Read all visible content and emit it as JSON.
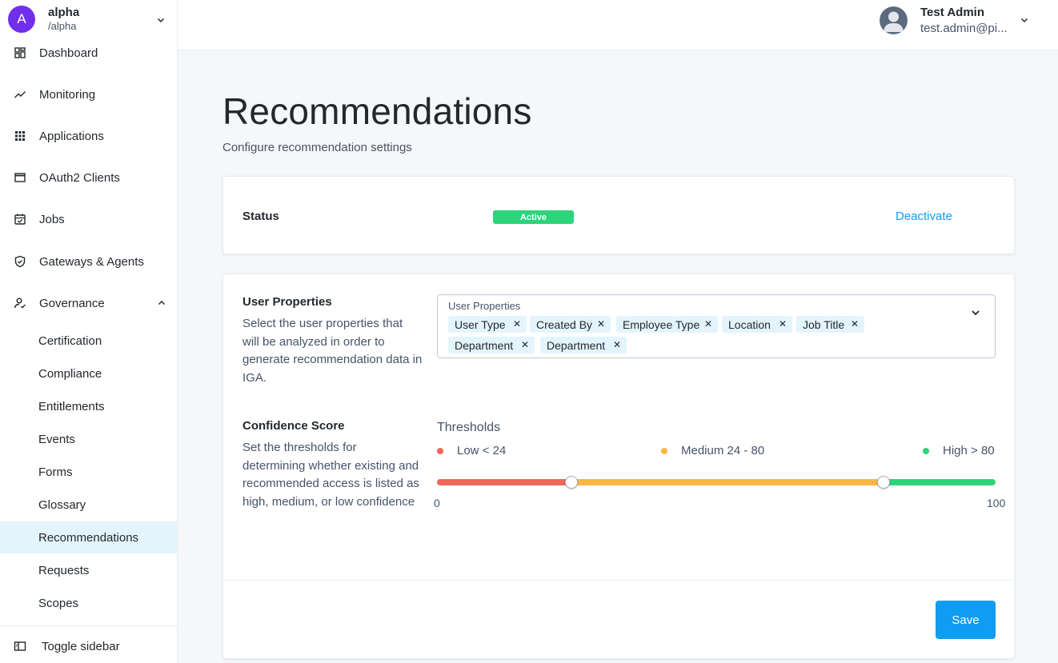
{
  "realm": {
    "initial": "A",
    "name": "alpha",
    "path": "/alpha"
  },
  "sidebar": {
    "items": [
      {
        "label": "Dashboard",
        "icon": "dashboard-icon"
      },
      {
        "label": "Monitoring",
        "icon": "trending-icon"
      },
      {
        "label": "Applications",
        "icon": "apps-grid-icon"
      },
      {
        "label": "OAuth2 Clients",
        "icon": "window-icon"
      },
      {
        "label": "Jobs",
        "icon": "calendar-check-icon"
      },
      {
        "label": "Gateways & Agents",
        "icon": "shield-check-icon"
      },
      {
        "label": "Governance",
        "icon": "governance-icon"
      }
    ],
    "governance_sub": [
      "Certification",
      "Compliance",
      "Entitlements",
      "Events",
      "Forms",
      "Glossary",
      "Recommendations",
      "Requests",
      "Scopes"
    ],
    "active": "Recommendations",
    "toggle_label": "Toggle sidebar"
  },
  "user": {
    "name": "Test Admin",
    "email": "test.admin@pi..."
  },
  "page": {
    "title": "Recommendations",
    "subtitle": "Configure recommendation settings"
  },
  "status": {
    "label": "Status",
    "badge": "Active",
    "action": "Deactivate"
  },
  "user_properties": {
    "title": "User Properties",
    "description": "Select the user properties that will be analyzed in order to generate recommendation data in IGA.",
    "field_label": "User Properties",
    "tags": [
      "User Type",
      "Created By",
      "Employee Type",
      "Location",
      "Job Title",
      "Department",
      "Department"
    ]
  },
  "confidence": {
    "title": "Confidence Score",
    "description": "Set the thresholds for determining whether existing and recommended access is listed as high, medium, or low confidence",
    "thresholds_label": "Thresholds",
    "low_label": "Low < 24",
    "medium_label": "Medium 24 - 80",
    "high_label": "High > 80",
    "min": "0",
    "max": "100",
    "low_threshold": 24,
    "high_threshold": 80,
    "colors": {
      "low": "#f0685b",
      "medium": "#fdb643",
      "high": "#2ed47a"
    }
  },
  "actions": {
    "save": "Save"
  }
}
